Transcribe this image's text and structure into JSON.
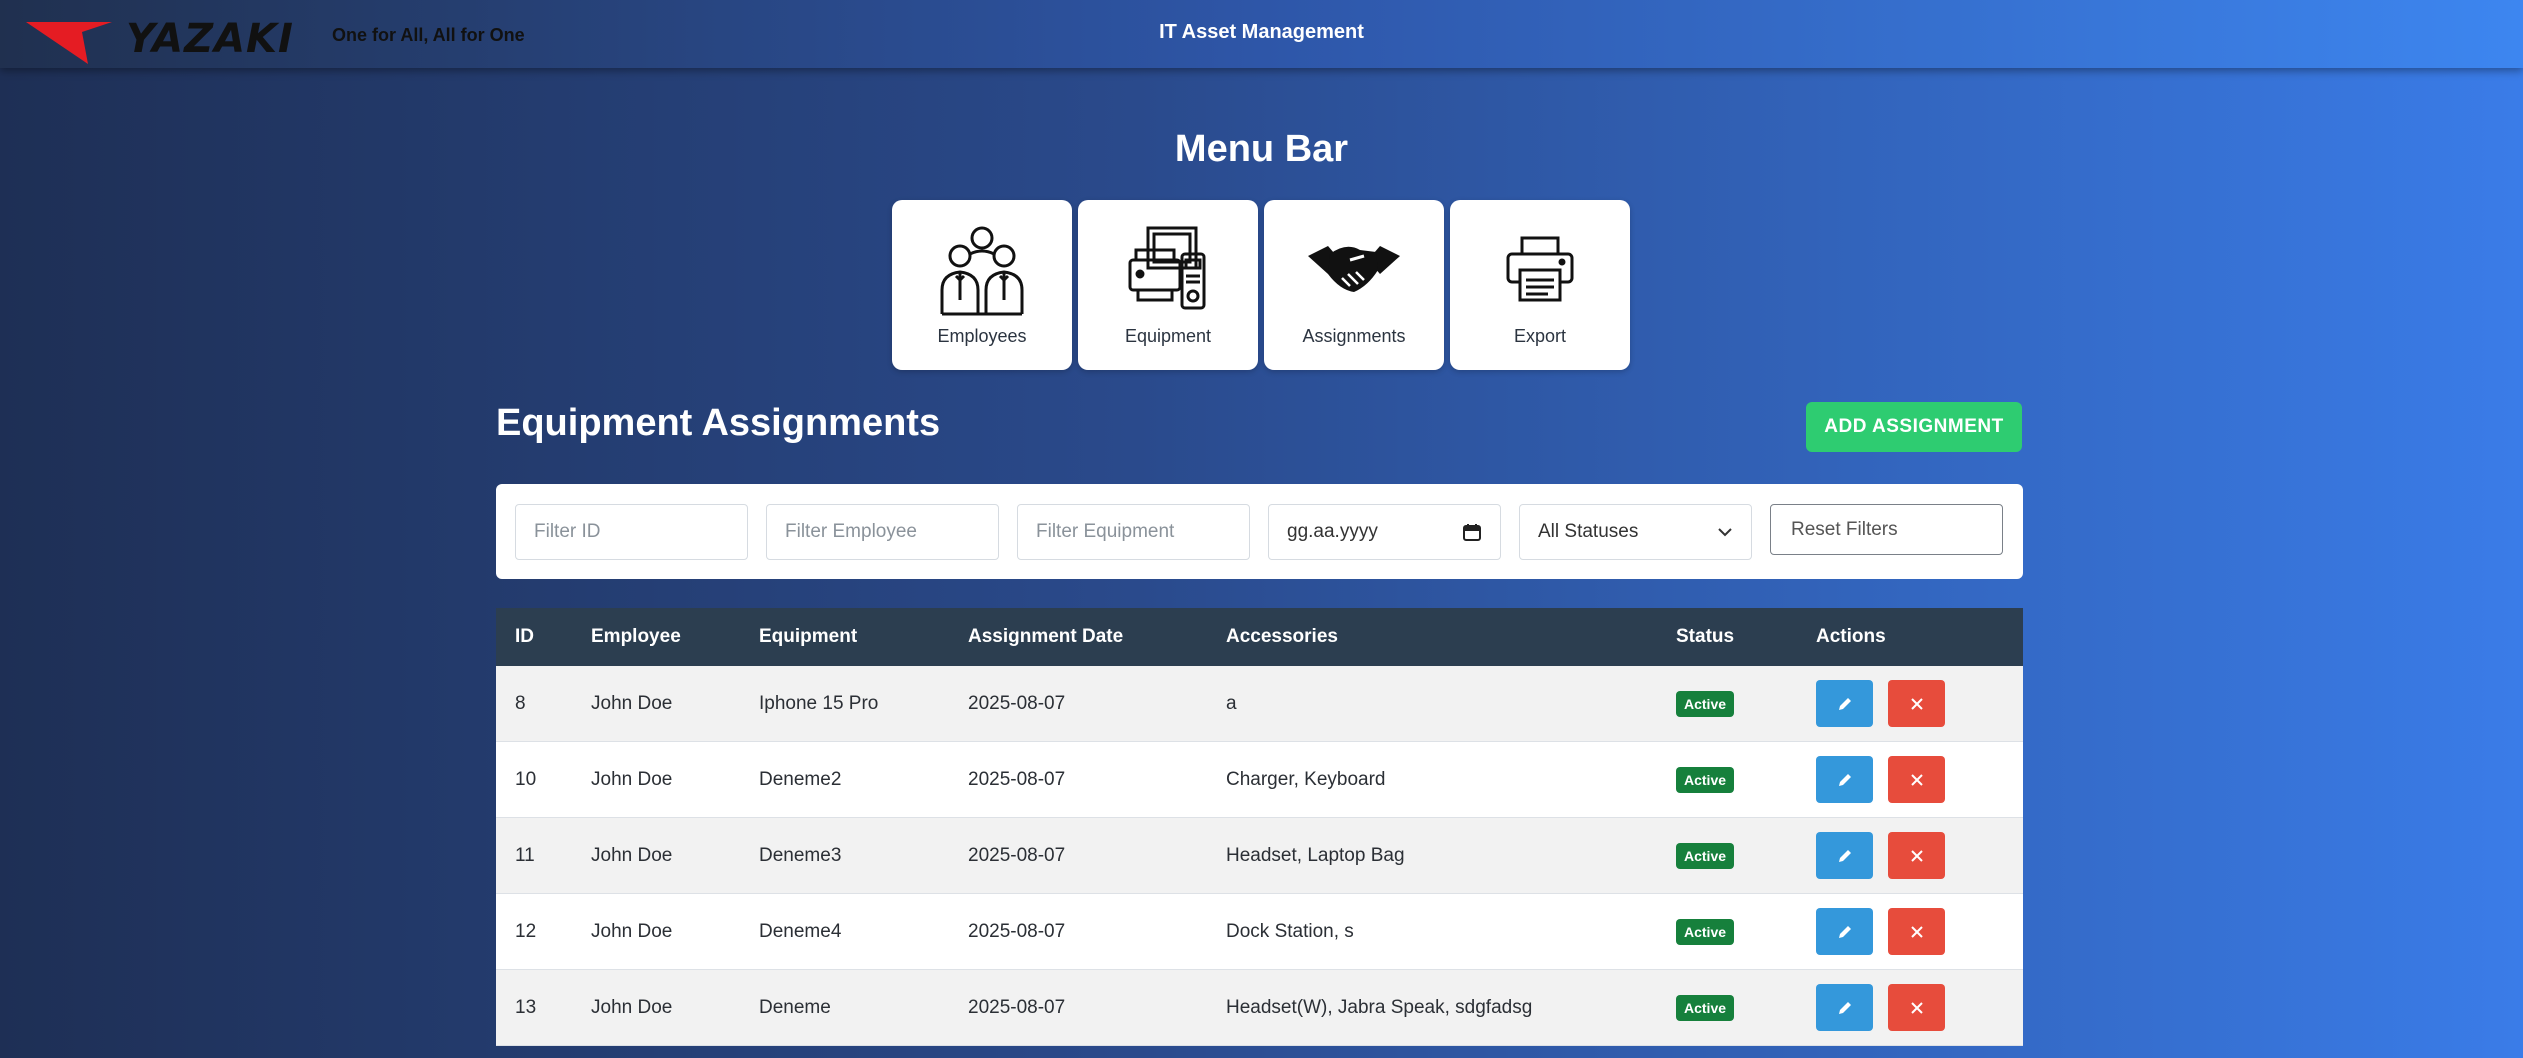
{
  "header": {
    "logo_text": "YAZAKI",
    "tagline": "One for All, All for One",
    "app_title": "IT Asset Management"
  },
  "menu": {
    "title": "Menu Bar",
    "items": [
      {
        "label": "Employees",
        "icon": "employees-icon"
      },
      {
        "label": "Equipment",
        "icon": "equipment-icon"
      },
      {
        "label": "Assignments",
        "icon": "handshake-icon"
      },
      {
        "label": "Export",
        "icon": "printer-icon"
      }
    ]
  },
  "section": {
    "title": "Equipment Assignments",
    "add_button": "ADD ASSIGNMENT"
  },
  "filters": {
    "id_placeholder": "Filter ID",
    "employee_placeholder": "Filter Employee",
    "equipment_placeholder": "Filter Equipment",
    "date_value": "gg.aa.yyyy",
    "status_value": "All Statuses",
    "reset_label": "Reset Filters"
  },
  "table": {
    "columns": [
      "ID",
      "Employee",
      "Equipment",
      "Assignment Date",
      "Accessories",
      "Status",
      "Actions"
    ],
    "rows": [
      {
        "id": "8",
        "employee": "John Doe",
        "equipment": "Iphone 15 Pro",
        "date": "2025-08-07",
        "accessories": "a",
        "status": "Active"
      },
      {
        "id": "10",
        "employee": "John Doe",
        "equipment": "Deneme2",
        "date": "2025-08-07",
        "accessories": "Charger, Keyboard",
        "status": "Active"
      },
      {
        "id": "11",
        "employee": "John Doe",
        "equipment": "Deneme3",
        "date": "2025-08-07",
        "accessories": "Headset, Laptop Bag",
        "status": "Active"
      },
      {
        "id": "12",
        "employee": "John Doe",
        "equipment": "Deneme4",
        "date": "2025-08-07",
        "accessories": "Dock Station, s",
        "status": "Active"
      },
      {
        "id": "13",
        "employee": "John Doe",
        "equipment": "Deneme",
        "date": "2025-08-07",
        "accessories": "Headset(W), Jabra Speak, sdgfadsg",
        "status": "Active"
      }
    ]
  },
  "colors": {
    "accent_green": "#2ecc71",
    "status_green": "#16803c",
    "edit_blue": "#3498db",
    "delete_red": "#e74c3c",
    "table_header": "#2c3e50"
  }
}
